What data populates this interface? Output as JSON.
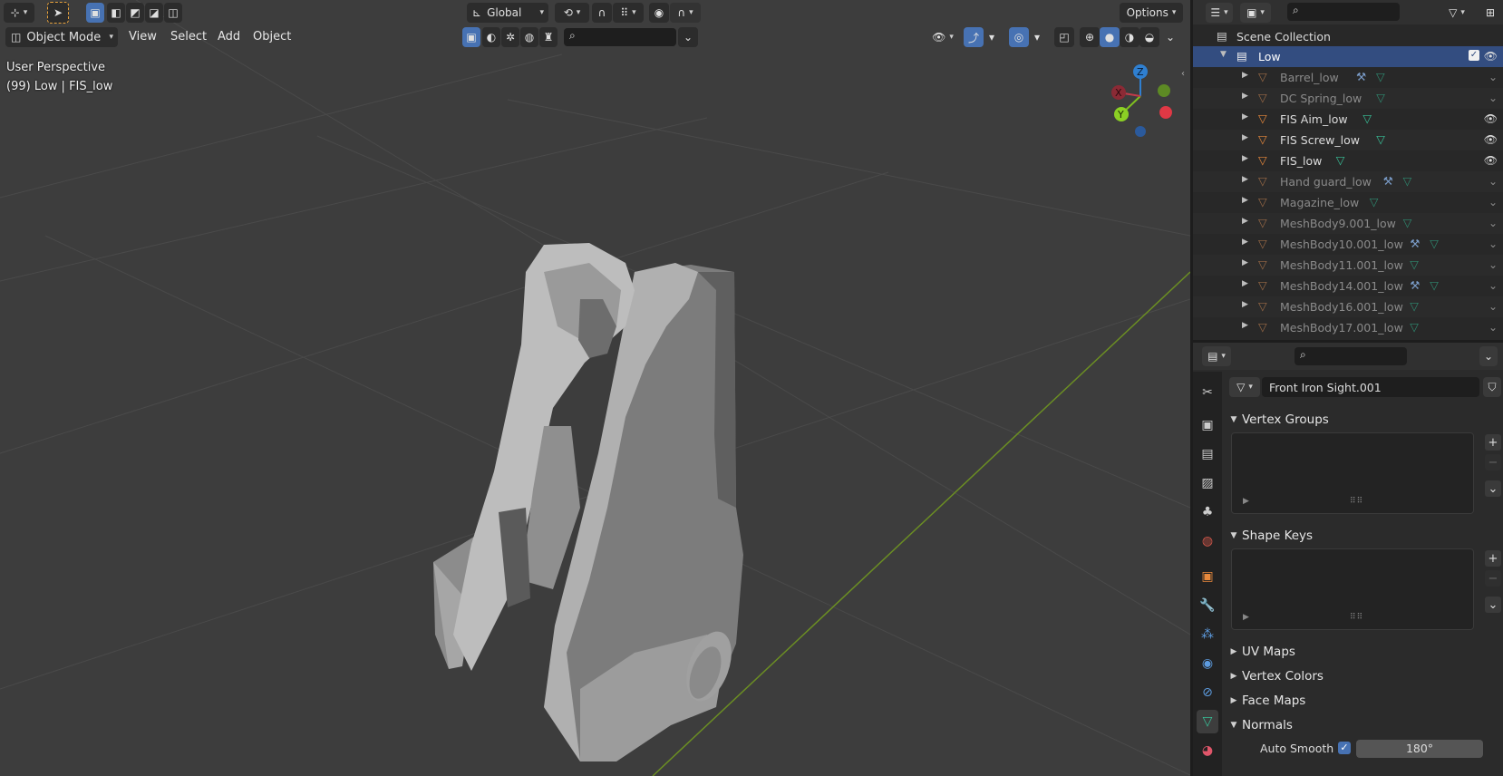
{
  "viewport": {
    "mode_label": "Object Mode",
    "menus": [
      "View",
      "Select",
      "Add",
      "Object"
    ],
    "transform_orientation": "Global",
    "options_label": "Options",
    "overlay_line1": "User Perspective",
    "overlay_line2": "(99) Low | FIS_low",
    "gizmo": {
      "z": "Z",
      "x": "X",
      "y": "Y"
    }
  },
  "outliner": {
    "root_label": "Scene Collection",
    "collection_label": "Low",
    "items": [
      {
        "label": "Barrel_low",
        "visible": false,
        "modifier": true
      },
      {
        "label": "DC Spring_low",
        "visible": false,
        "modifier": false
      },
      {
        "label": "FIS Aim_low",
        "visible": true,
        "modifier": false
      },
      {
        "label": "FIS Screw_low",
        "visible": true,
        "modifier": false
      },
      {
        "label": "FIS_low",
        "visible": true,
        "modifier": false
      },
      {
        "label": "Hand guard_low",
        "visible": false,
        "modifier": true
      },
      {
        "label": "Magazine_low",
        "visible": false,
        "modifier": false
      },
      {
        "label": "MeshBody9.001_low",
        "visible": false,
        "modifier": false
      },
      {
        "label": "MeshBody10.001_low",
        "visible": false,
        "modifier": true
      },
      {
        "label": "MeshBody11.001_low",
        "visible": false,
        "modifier": false
      },
      {
        "label": "MeshBody14.001_low",
        "visible": false,
        "modifier": true
      },
      {
        "label": "MeshBody16.001_low",
        "visible": false,
        "modifier": false
      },
      {
        "label": "MeshBody17.001_low",
        "visible": false,
        "modifier": false
      }
    ]
  },
  "properties": {
    "mesh_name": "Front Iron Sight.001",
    "panels": {
      "vertex_groups": "Vertex Groups",
      "shape_keys": "Shape Keys",
      "uv_maps": "UV Maps",
      "vertex_colors": "Vertex Colors",
      "face_maps": "Face Maps",
      "normals": "Normals"
    },
    "auto_smooth_label": "Auto Smooth",
    "auto_smooth_angle": "180°"
  },
  "colors": {
    "selected": "#4772b3",
    "mesh_icon": "#e8893c",
    "data_icon": "#38c098",
    "active_row": "#334d80"
  }
}
